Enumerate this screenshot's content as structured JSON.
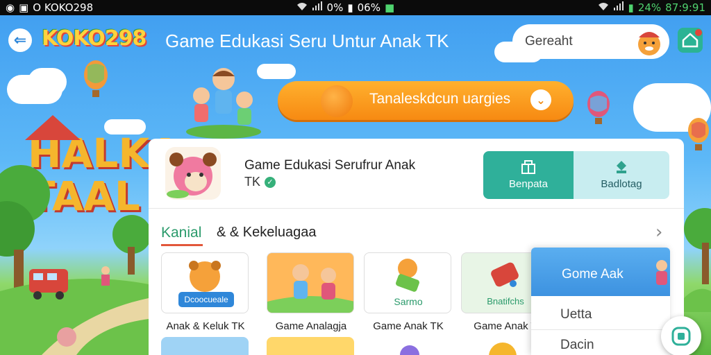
{
  "status_bar": {
    "left_text": "O KOKO298",
    "mid_percent": "0%",
    "mid_value": "06%",
    "right_percent": "24%",
    "right_time": "87:9:91"
  },
  "header": {
    "logo": "KOKO298",
    "title": "Game Edukasi Seru Untur Anak TK",
    "search_placeholder": "Gereaht"
  },
  "banner": {
    "bg_text_line1": "HALKA",
    "bg_text_line2": "TAAL",
    "pill_text": "Tanaleskdcun uargies"
  },
  "app": {
    "name": "Game Edukasi Serufrur Anak",
    "subtitle": "TK",
    "install_label": "Benpata",
    "details_label": "Badlotag"
  },
  "section": {
    "tab_active": "Kanial",
    "tab_other": "& & Kekeluagaa",
    "tiles": [
      {
        "label": "Anak & Keluk TK",
        "inner": "Dcoocueale"
      },
      {
        "label": "Game Analagja",
        "inner": ""
      },
      {
        "label": "Game Anak TK",
        "inner": "Sarmo"
      },
      {
        "label": "Game Anak T",
        "inner": "Bnatifchs"
      }
    ]
  },
  "dropdown": {
    "header": "Gome Aak",
    "items": [
      "Uetta",
      "Dacin"
    ]
  },
  "colors": {
    "accent_orange": "#f78a12",
    "teal": "#2fb09a",
    "section_green": "#2a9a6b"
  }
}
